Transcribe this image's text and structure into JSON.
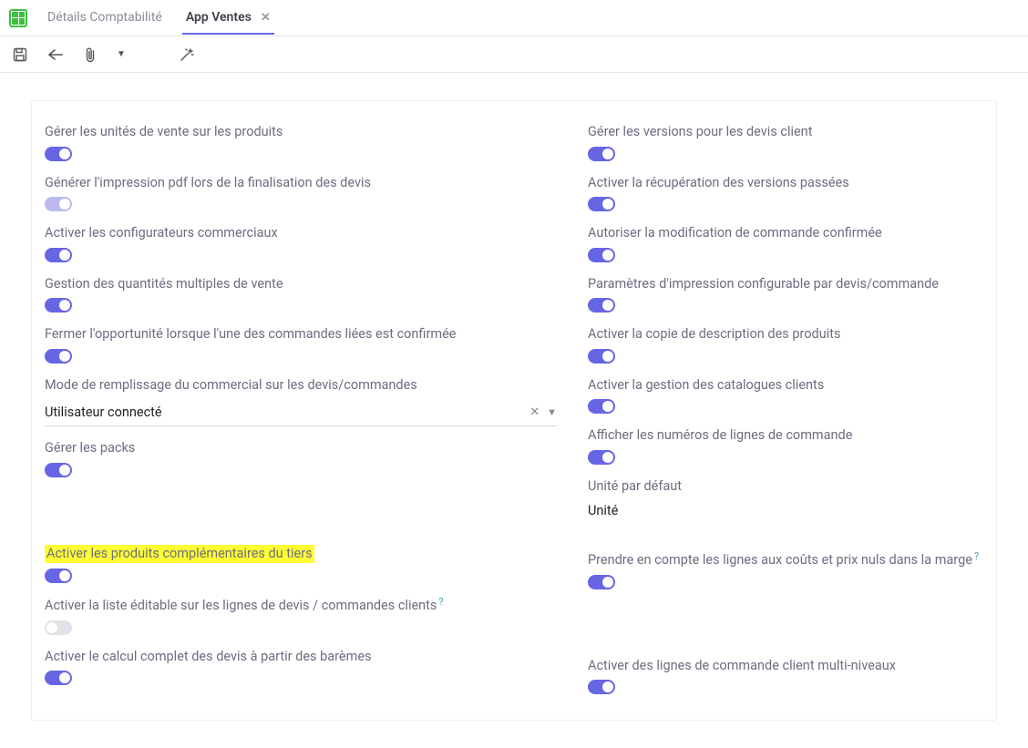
{
  "tabs": {
    "inactive": "Détails Comptabilité",
    "active": "App Ventes"
  },
  "left": [
    {
      "id": "units",
      "label": "Gérer les unités de vente sur les produits",
      "toggle": "on"
    },
    {
      "id": "pdf",
      "label": "Générer l'impression pdf lors de la finalisation des devis",
      "toggle": "disabled-on"
    },
    {
      "id": "configurators",
      "label": "Activer les configurateurs commerciaux",
      "toggle": "on"
    },
    {
      "id": "multqty",
      "label": "Gestion des quantités multiples de vente",
      "toggle": "on"
    },
    {
      "id": "closeopp",
      "label": "Fermer l'opportunité lorsque l'une des commandes liées est confirmée",
      "toggle": "on"
    },
    {
      "id": "fillmode",
      "label": "Mode de remplissage du commercial sur les devis/commandes",
      "type": "select",
      "value": "Utilisateur connecté"
    },
    {
      "id": "packs",
      "label": "Gérer les packs",
      "toggle": "on"
    },
    {
      "id": "complprod",
      "label": "Activer les produits complémentaires du tiers",
      "toggle": "on",
      "highlight": true
    },
    {
      "id": "editlist",
      "label": "Activer la liste éditable sur les lignes de devis / commandes clients",
      "toggle": "disabled-off",
      "help": true
    },
    {
      "id": "fullcalc",
      "label": "Activer le calcul complet des devis à partir des barèmes",
      "toggle": "on"
    }
  ],
  "right": [
    {
      "id": "versions",
      "label": "Gérer les versions pour les devis client",
      "toggle": "on"
    },
    {
      "id": "recovpast",
      "label": "Activer la récupération des versions passées",
      "toggle": "on"
    },
    {
      "id": "modconfirmed",
      "label": "Autoriser la modification de commande confirmée",
      "toggle": "on"
    },
    {
      "id": "printparams",
      "label": "Paramètres d'impression configurable par devis/commande",
      "toggle": "on"
    },
    {
      "id": "copydesc",
      "label": "Activer la copie de description des produits",
      "toggle": "on"
    },
    {
      "id": "catalogs",
      "label": "Activer la gestion des catalogues clients",
      "toggle": "on"
    },
    {
      "id": "linenum",
      "label": "Afficher les numéros de lignes de commande",
      "toggle": "on"
    },
    {
      "id": "defunit",
      "label": "Unité par défaut",
      "type": "text",
      "value": "Unité"
    },
    {
      "id": "zerocost",
      "label": "Prendre en compte les lignes aux coûts et prix nuls dans la marge",
      "toggle": "on",
      "help": true
    },
    {
      "id": "multilevel",
      "label": "Activer des lignes de commande client multi-niveaux",
      "toggle": "on"
    }
  ]
}
